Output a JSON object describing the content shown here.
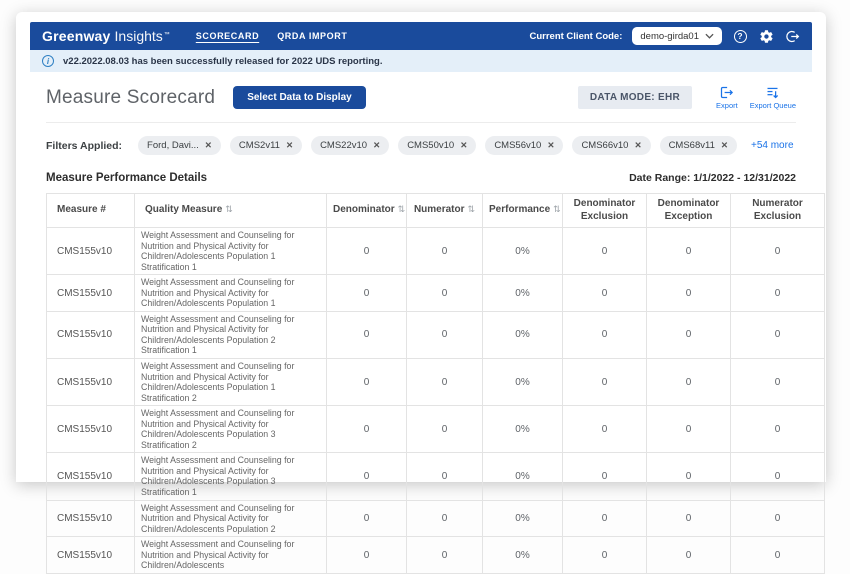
{
  "colors": {
    "header_blue": "#1a4b9c",
    "link_blue": "#1a73e8",
    "banner_bg": "#e4eff9",
    "badge_bg": "#e7ebf1"
  },
  "header": {
    "brand": {
      "bold": "Greenway",
      "light": "Insights",
      "tm": "™"
    },
    "nav": [
      {
        "label": "SCORECARD",
        "active": true
      },
      {
        "label": "QRDA IMPORT",
        "active": false
      }
    ],
    "client_code_label": "Current Client Code:",
    "client_code_value": "demo-girda01",
    "icons": [
      "help-icon",
      "settings-gear-icon",
      "logout-icon"
    ]
  },
  "banner": {
    "text": "v22.2022.08.03 has been successfully released for 2022 UDS reporting."
  },
  "toolbar": {
    "page_title": "Measure Scorecard",
    "select_data_button": "Select Data to Display",
    "data_mode_badge": "DATA MODE: EHR",
    "export_label": "Export",
    "export_queue_label": "Export Queue"
  },
  "filters": {
    "label": "Filters Applied:",
    "chips": [
      "Ford, Davi...",
      "CMS2v11",
      "CMS22v10",
      "CMS50v10",
      "CMS56v10",
      "CMS66v10",
      "CMS68v11"
    ],
    "more_link": "+54 more"
  },
  "details": {
    "title": "Measure Performance Details",
    "date_range": "Date Range: 1/1/2022 - 12/31/2022"
  },
  "table": {
    "columns": [
      {
        "label": "Measure #",
        "sortable": false,
        "align": "left"
      },
      {
        "label": "Quality Measure",
        "sortable": true,
        "align": "left"
      },
      {
        "label": "Denominator",
        "sortable": true,
        "align": "center"
      },
      {
        "label": "Numerator",
        "sortable": true,
        "align": "center"
      },
      {
        "label": "Performance",
        "sortable": true,
        "align": "center"
      },
      {
        "label": "Denominator Exclusion",
        "sortable": false,
        "align": "center"
      },
      {
        "label": "Denominator Exception",
        "sortable": false,
        "align": "center"
      },
      {
        "label": "Numerator Exclusion",
        "sortable": false,
        "align": "center"
      }
    ],
    "rows": [
      {
        "measure": "CMS155v10",
        "quality": "Weight Assessment and Counseling for Nutrition and Physical Activity for Children/Adolescents Population 1 Stratification 1",
        "denominator": "0",
        "numerator": "0",
        "performance": "0%",
        "denominator_exclusion": "0",
        "denominator_exception": "0",
        "numerator_exclusion": "0"
      },
      {
        "measure": "CMS155v10",
        "quality": "Weight Assessment and Counseling for Nutrition and Physical Activity for Children/Adolescents Population 1",
        "denominator": "0",
        "numerator": "0",
        "performance": "0%",
        "denominator_exclusion": "0",
        "denominator_exception": "0",
        "numerator_exclusion": "0"
      },
      {
        "measure": "CMS155v10",
        "quality": "Weight Assessment and Counseling for Nutrition and Physical Activity for Children/Adolescents Population 2 Stratification 1",
        "denominator": "0",
        "numerator": "0",
        "performance": "0%",
        "denominator_exclusion": "0",
        "denominator_exception": "0",
        "numerator_exclusion": "0"
      },
      {
        "measure": "CMS155v10",
        "quality": "Weight Assessment and Counseling for Nutrition and Physical Activity for Children/Adolescents Population 1 Stratification 2",
        "denominator": "0",
        "numerator": "0",
        "performance": "0%",
        "denominator_exclusion": "0",
        "denominator_exception": "0",
        "numerator_exclusion": "0"
      },
      {
        "measure": "CMS155v10",
        "quality": "Weight Assessment and Counseling for Nutrition and Physical Activity for Children/Adolescents Population 3 Stratification 2",
        "denominator": "0",
        "numerator": "0",
        "performance": "0%",
        "denominator_exclusion": "0",
        "denominator_exception": "0",
        "numerator_exclusion": "0"
      },
      {
        "measure": "CMS155v10",
        "quality": "Weight Assessment and Counseling for Nutrition and Physical Activity for Children/Adolescents Population 3 Stratification 1",
        "denominator": "0",
        "numerator": "0",
        "performance": "0%",
        "denominator_exclusion": "0",
        "denominator_exception": "0",
        "numerator_exclusion": "0"
      },
      {
        "measure": "CMS155v10",
        "quality": "Weight Assessment and Counseling for Nutrition and Physical Activity for Children/Adolescents Population 2",
        "denominator": "0",
        "numerator": "0",
        "performance": "0%",
        "denominator_exclusion": "0",
        "denominator_exception": "0",
        "numerator_exclusion": "0"
      },
      {
        "measure": "CMS155v10",
        "quality": "Weight Assessment and Counseling for Nutrition and Physical Activity for Children/Adolescents",
        "denominator": "0",
        "numerator": "0",
        "performance": "0%",
        "denominator_exclusion": "0",
        "denominator_exception": "0",
        "numerator_exclusion": "0"
      }
    ]
  }
}
